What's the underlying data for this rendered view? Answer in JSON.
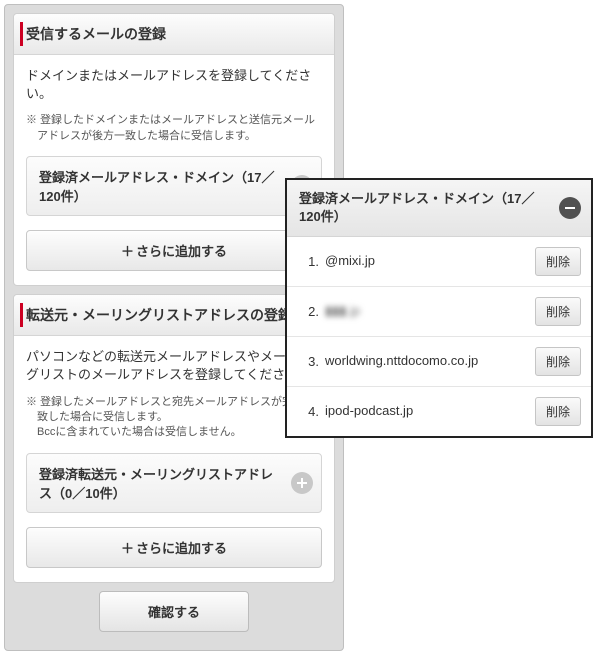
{
  "left": {
    "section1": {
      "title": "受信するメールの登録",
      "desc": "ドメインまたはメールアドレスを登録してください。",
      "note": "※ 登録したドメインまたはメールアドレスと送信元メールアドレスが後方一致した場合に受信します。",
      "row_label": "登録済メールアドレス・ドメイン（17／120件）",
      "add_more": "さらに追加する"
    },
    "section2": {
      "title": "転送元・メーリングリストアドレスの登録",
      "desc": "パソコンなどの転送元メールアドレスやメーリングリストのメールアドレスを登録してください。",
      "note": "※ 登録したメールアドレスと宛先メールアドレスが完全一致した場合に受信します。\nBccに含まれていた場合は受信しません。",
      "row_label": "登録済転送元・メーリングリストアドレス（0／10件）",
      "add_more": "さらに追加する"
    },
    "confirm": "確認する"
  },
  "popup": {
    "header": "登録済メールアドレス・ドメイン（17／120件）",
    "delete_label": "削除",
    "items": [
      {
        "idx": "1.",
        "text": "@mixi.jp",
        "blurred": false
      },
      {
        "idx": "2.",
        "text": "▮▮▮.jp",
        "blurred": true
      },
      {
        "idx": "3.",
        "text": "worldwing.nttdocomo.co.jp",
        "blurred": false
      },
      {
        "idx": "4.",
        "text": "ipod-podcast.jp",
        "blurred": false
      }
    ]
  }
}
